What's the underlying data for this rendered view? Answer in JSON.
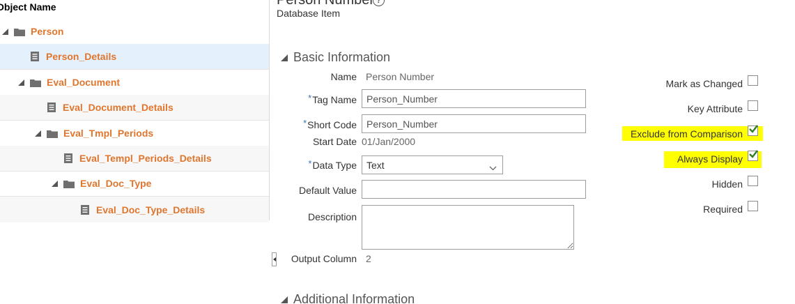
{
  "tree": {
    "header": "Object Name",
    "items": [
      {
        "label": "Person",
        "type": "folder",
        "expanded": true
      },
      {
        "label": "Person_Details",
        "type": "document",
        "selected": true
      },
      {
        "label": "Eval_Document",
        "type": "folder",
        "expanded": true
      },
      {
        "label": "Eval_Document_Details",
        "type": "document"
      },
      {
        "label": "Eval_Tmpl_Periods",
        "type": "folder",
        "expanded": true
      },
      {
        "label": "Eval_Templ_Periods_Details",
        "type": "document"
      },
      {
        "label": "Eval_Doc_Type",
        "type": "folder",
        "expanded": true
      },
      {
        "label": "Eval_Doc_Type_Details",
        "type": "document"
      }
    ]
  },
  "page": {
    "title": "Person Number",
    "help_icon": "question-circle-icon",
    "subtitle": "Database Item"
  },
  "sections": {
    "basic": "Basic Information",
    "additional": "Additional Information"
  },
  "form": {
    "name_label": "Name",
    "name_value": "Person Number",
    "tag_name_label": "Tag Name",
    "tag_name_value": "Person_Number",
    "short_code_label": "Short Code",
    "short_code_value": "Person_Number",
    "start_date_label": "Start Date",
    "start_date_value": "01/Jan/2000",
    "data_type_label": "Data Type",
    "data_type_value": "Text",
    "default_value_label": "Default Value",
    "default_value_value": "",
    "description_label": "Description",
    "description_value": "",
    "output_column_label": "Output Column",
    "output_column_value": "2",
    "required_marker": "*"
  },
  "options": [
    {
      "label": "Mark as Changed",
      "checked": false,
      "highlighted": false
    },
    {
      "label": "Key Attribute",
      "checked": false,
      "highlighted": false
    },
    {
      "label": "Exclude from Comparison",
      "checked": true,
      "highlighted": true
    },
    {
      "label": "Always Display",
      "checked": true,
      "highlighted": true
    },
    {
      "label": "Hidden",
      "checked": false,
      "highlighted": false
    },
    {
      "label": "Required",
      "checked": false,
      "highlighted": false
    }
  ],
  "colors": {
    "tree_link": "#e0762e",
    "selected_row": "#e4f0fb",
    "highlight": "#ffff00",
    "check": "#2e7d1e",
    "required": "#3b73b9"
  }
}
